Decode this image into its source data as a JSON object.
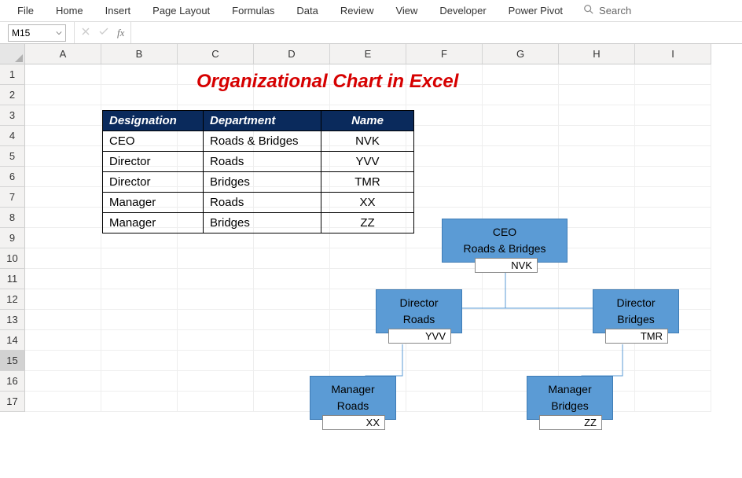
{
  "ribbon": {
    "tabs": [
      "File",
      "Home",
      "Insert",
      "Page Layout",
      "Formulas",
      "Data",
      "Review",
      "View",
      "Developer",
      "Power Pivot"
    ],
    "search_placeholder": "Search"
  },
  "fx": {
    "name_box": "M15",
    "fx_label": "fx"
  },
  "columns": [
    "A",
    "B",
    "C",
    "D",
    "E",
    "F",
    "G",
    "H",
    "I"
  ],
  "rows": [
    "1",
    "2",
    "3",
    "4",
    "5",
    "6",
    "7",
    "8",
    "9",
    "10",
    "11",
    "12",
    "13",
    "14",
    "15",
    "16",
    "17"
  ],
  "selected_row": "15",
  "title": "Organizational Chart in Excel",
  "table": {
    "headers": [
      "Designation",
      "Department",
      "Name"
    ],
    "rows": [
      [
        "CEO",
        "Roads & Bridges",
        "NVK"
      ],
      [
        "Director",
        "Roads",
        "YVV"
      ],
      [
        "Director",
        "Bridges",
        "TMR"
      ],
      [
        "Manager",
        "Roads",
        "XX"
      ],
      [
        "Manager",
        "Bridges",
        "ZZ"
      ]
    ]
  },
  "org": {
    "ceo": {
      "title": "CEO",
      "dept": "Roads & Bridges",
      "name": "NVK"
    },
    "dir1": {
      "title": "Director",
      "dept": "Roads",
      "name": "YVV"
    },
    "dir2": {
      "title": "Director",
      "dept": "Bridges",
      "name": "TMR"
    },
    "mgr1": {
      "title": "Manager",
      "dept": "Roads",
      "name": "XX"
    },
    "mgr2": {
      "title": "Manager",
      "dept": "Bridges",
      "name": "ZZ"
    }
  }
}
